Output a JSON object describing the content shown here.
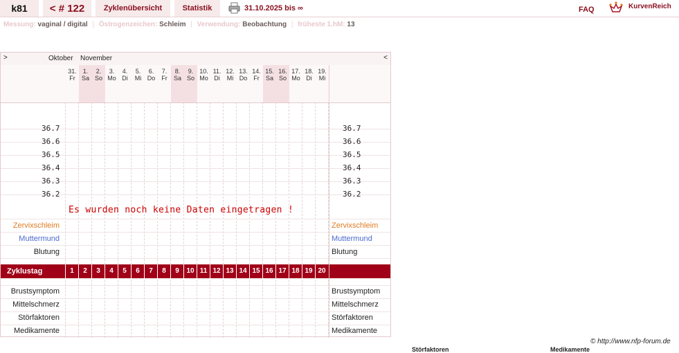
{
  "nav": {
    "user": "k81",
    "cycle": "< # 122",
    "overview": "Zyklenübersicht",
    "statistics": "Statistik",
    "daterange": "31.10.2025 bis ∞",
    "faq": "FAQ",
    "brand": "KurvenReich",
    "printer_icon": "printer-icon"
  },
  "info": {
    "measure_label": "Messung:",
    "measure_value": "vaginal / digital",
    "estrogen_label": "Östrogenzeichen:",
    "estrogen_value": "Schleim",
    "use_label": "Verwendung:",
    "use_value": "Beobachtung",
    "early_label": "früheste 1.hM:",
    "early_value": "13"
  },
  "chart": {
    "nav_prev": ">",
    "nav_next": "<",
    "month1": "Oktober",
    "month2": "November",
    "days": [
      {
        "d": "31.",
        "w": "Fr"
      },
      {
        "d": "1.",
        "w": "Sa"
      },
      {
        "d": "2.",
        "w": "So"
      },
      {
        "d": "3.",
        "w": "Mo"
      },
      {
        "d": "4.",
        "w": "Di"
      },
      {
        "d": "5.",
        "w": "Mi"
      },
      {
        "d": "6.",
        "w": "Do"
      },
      {
        "d": "7.",
        "w": "Fr"
      },
      {
        "d": "8.",
        "w": "Sa"
      },
      {
        "d": "9.",
        "w": "So"
      },
      {
        "d": "10.",
        "w": "Mo"
      },
      {
        "d": "11.",
        "w": "Di"
      },
      {
        "d": "12.",
        "w": "Mi"
      },
      {
        "d": "13.",
        "w": "Do"
      },
      {
        "d": "14.",
        "w": "Fr"
      },
      {
        "d": "15.",
        "w": "Sa"
      },
      {
        "d": "16.",
        "w": "So"
      },
      {
        "d": "17.",
        "w": "Mo"
      },
      {
        "d": "18.",
        "w": "Di"
      },
      {
        "d": "19.",
        "w": "Mi"
      }
    ],
    "temps": [
      "36.7",
      "36.6",
      "36.5",
      "36.4",
      "36.3",
      "36.2"
    ],
    "nodata": "Es wurden noch keine Daten eingetragen !",
    "row_cervix": "Zervixschleim",
    "row_cervix_os": "Muttermund",
    "row_bleeding": "Blutung",
    "cycle_label": "Zyklustag",
    "cycle_days": [
      "1",
      "2",
      "3",
      "4",
      "5",
      "6",
      "7",
      "8",
      "9",
      "10",
      "11",
      "12",
      "13",
      "14",
      "15",
      "16",
      "17",
      "18",
      "19",
      "20"
    ],
    "row_breast": "Brustsymptom",
    "row_midpain": "Mittelschmerz",
    "row_disturb": "Störfaktoren",
    "row_meds": "Medikamente"
  },
  "footer": {
    "credit": "© http://www.nfp-forum.de",
    "cut_left": "Störfaktoren",
    "cut_right": "Medikamente"
  },
  "colors": {
    "brand": "#8a1020",
    "cycle_bar": "#a00018",
    "weekend": "#f4e0e3"
  }
}
